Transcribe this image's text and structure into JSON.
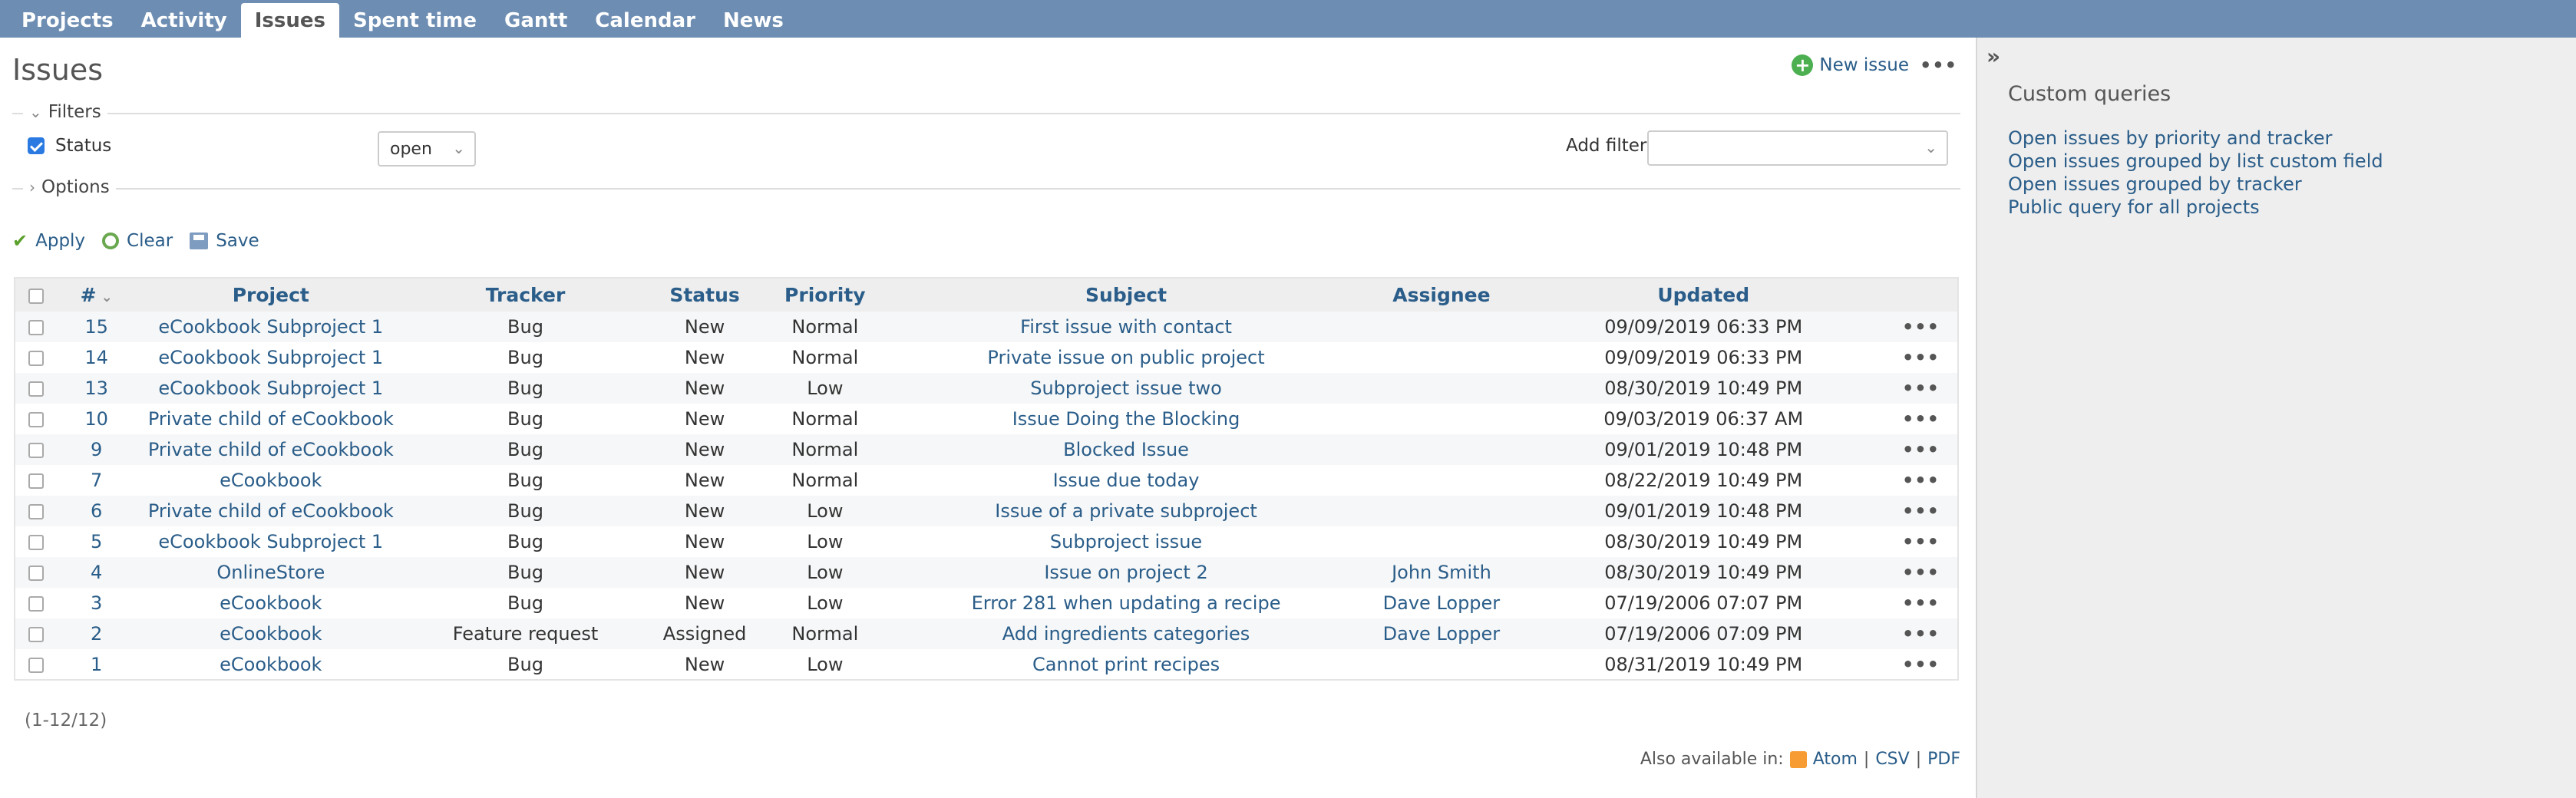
{
  "menu": [
    "Projects",
    "Activity",
    "Issues",
    "Spent time",
    "Gantt",
    "Calendar",
    "News"
  ],
  "page_title": "Issues",
  "contextual": {
    "new_issue": "New issue"
  },
  "filters": {
    "legend": "Filters",
    "status_label": "Status",
    "status_operator": "open",
    "add_filter_label": "Add filter",
    "add_filter_value": ""
  },
  "options": {
    "legend": "Options"
  },
  "actions": {
    "apply": "Apply",
    "clear": "Clear",
    "save": "Save"
  },
  "table": {
    "headers": [
      "#",
      "Project",
      "Tracker",
      "Status",
      "Priority",
      "Subject",
      "Assignee",
      "Updated"
    ],
    "rows": [
      {
        "id": "15",
        "project": "eCookbook Subproject 1",
        "tracker": "Bug",
        "status": "New",
        "priority": "Normal",
        "subject": "First issue with contact",
        "assignee": "",
        "updated": "09/09/2019 06:33 PM"
      },
      {
        "id": "14",
        "project": "eCookbook Subproject 1",
        "tracker": "Bug",
        "status": "New",
        "priority": "Normal",
        "subject": "Private issue on public project",
        "assignee": "",
        "updated": "09/09/2019 06:33 PM"
      },
      {
        "id": "13",
        "project": "eCookbook Subproject 1",
        "tracker": "Bug",
        "status": "New",
        "priority": "Low",
        "subject": "Subproject issue two",
        "assignee": "",
        "updated": "08/30/2019 10:49 PM"
      },
      {
        "id": "10",
        "project": "Private child of eCookbook",
        "tracker": "Bug",
        "status": "New",
        "priority": "Normal",
        "subject": "Issue Doing the Blocking",
        "assignee": "",
        "updated": "09/03/2019 06:37 AM"
      },
      {
        "id": "9",
        "project": "Private child of eCookbook",
        "tracker": "Bug",
        "status": "New",
        "priority": "Normal",
        "subject": "Blocked Issue",
        "assignee": "",
        "updated": "09/01/2019 10:48 PM"
      },
      {
        "id": "7",
        "project": "eCookbook",
        "tracker": "Bug",
        "status": "New",
        "priority": "Normal",
        "subject": "Issue due today",
        "assignee": "",
        "updated": "08/22/2019 10:49 PM"
      },
      {
        "id": "6",
        "project": "Private child of eCookbook",
        "tracker": "Bug",
        "status": "New",
        "priority": "Low",
        "subject": "Issue of a private subproject",
        "assignee": "",
        "updated": "09/01/2019 10:48 PM"
      },
      {
        "id": "5",
        "project": "eCookbook Subproject 1",
        "tracker": "Bug",
        "status": "New",
        "priority": "Low",
        "subject": "Subproject issue",
        "assignee": "",
        "updated": "08/30/2019 10:49 PM"
      },
      {
        "id": "4",
        "project": "OnlineStore",
        "tracker": "Bug",
        "status": "New",
        "priority": "Low",
        "subject": "Issue on project 2",
        "assignee": "John Smith",
        "updated": "08/30/2019 10:49 PM"
      },
      {
        "id": "3",
        "project": "eCookbook",
        "tracker": "Bug",
        "status": "New",
        "priority": "Low",
        "subject": "Error 281 when updating a recipe",
        "assignee": "Dave Lopper",
        "updated": "07/19/2006 07:07 PM"
      },
      {
        "id": "2",
        "project": "eCookbook",
        "tracker": "Feature request",
        "status": "Assigned",
        "priority": "Normal",
        "subject": "Add ingredients categories",
        "assignee": "Dave Lopper",
        "updated": "07/19/2006 07:09 PM"
      },
      {
        "id": "1",
        "project": "eCookbook",
        "tracker": "Bug",
        "status": "New",
        "priority": "Low",
        "subject": "Cannot print recipes",
        "assignee": "",
        "updated": "08/31/2019 10:49 PM"
      }
    ]
  },
  "pagination": "(1-12/12)",
  "other_formats": {
    "label": "Also available in:",
    "atom": "Atom",
    "csv": "CSV",
    "pdf": "PDF",
    "sep": "|"
  },
  "sidebar": {
    "title": "Custom queries",
    "queries": [
      "Open issues by priority and tracker",
      "Open issues grouped by list custom field",
      "Open issues grouped by tracker",
      "Public query for all projects"
    ]
  }
}
